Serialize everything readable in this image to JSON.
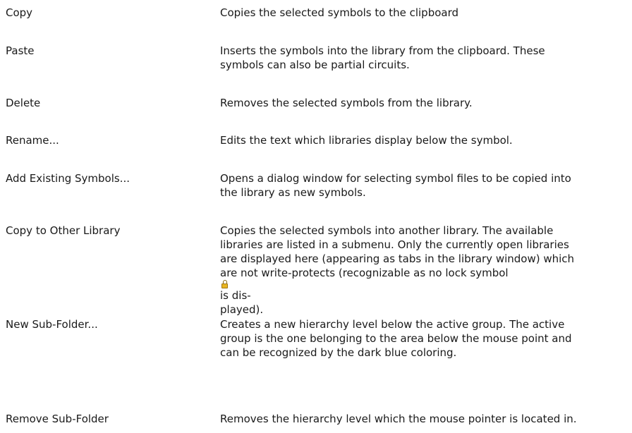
{
  "entries": [
    {
      "term": "Copy",
      "lines": [
        "Copies the selected symbols to the clipboard"
      ]
    },
    {
      "term": "Paste",
      "lines": [
        "Inserts the symbols into the library from the clipboard. These",
        "symbols can also be partial circuits."
      ]
    },
    {
      "term": "Delete",
      "lines": [
        "Removes the selected symbols from the library."
      ]
    },
    {
      "term": "Rename...",
      "lines": [
        "Edits the text which libraries display below the symbol."
      ]
    },
    {
      "term": "Add Existing Symbols...",
      "lines": [
        "Opens a dialog window for selecting symbol files to be copied into",
        "the library as new symbols."
      ]
    },
    {
      "term": "Copy to Other Library",
      "lines": [
        "Copies the selected symbols into another library. The available",
        "libraries are listed in a submenu. Only the currently open libraries",
        "are displayed here (appearing as tabs in the library window) which"
      ],
      "lock_line_before": "are not write-protects (recognizable as no lock symbol",
      "lock_line_after": "is dis-",
      "last_line": "played)."
    },
    {
      "term": "New Sub-Folder...",
      "lines": [
        "Creates a new hierarchy level below the active group. The active",
        "group is the one belonging to the area below the mouse point and",
        "can be recognized by the dark blue coloring."
      ]
    },
    {
      "term": "Remove Sub-Folder",
      "lines": [
        "Removes the hierarchy level which the mouse pointer is located in."
      ]
    }
  ],
  "icons": {
    "lock": "lock-icon",
    "lock_color": "#e8b523"
  }
}
